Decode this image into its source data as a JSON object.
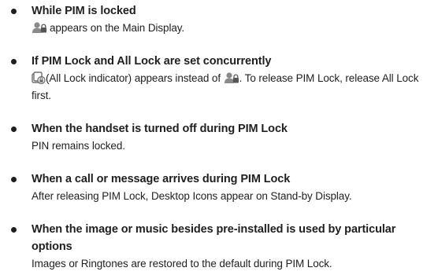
{
  "items": [
    {
      "heading": "While PIM is locked",
      "body_icon": "pim-lock-icon",
      "body": "appears on the Main Display."
    },
    {
      "heading": "If PIM Lock and All Lock are set concurrently",
      "body_icon": "all-lock-indicator-icon",
      "body_part1": "(All Lock indicator) appears instead of",
      "body_icon2": "pim-lock-icon",
      "body_part2": ". To release PIM Lock, release All Lock first."
    },
    {
      "heading": "When the handset is turned off during PIM Lock",
      "body": "PIN remains locked."
    },
    {
      "heading": "When a call or message arrives during PIM Lock",
      "body": "After releasing PIM Lock, Desktop Icons appear on Stand-by Display."
    },
    {
      "heading": "When the image or music besides pre-installed is used by particular options",
      "body": "Images or Ringtones are restored to the default during PIM Lock."
    }
  ],
  "colors": {
    "text": "#1f1f1f",
    "icon": "#6e6e6e"
  }
}
